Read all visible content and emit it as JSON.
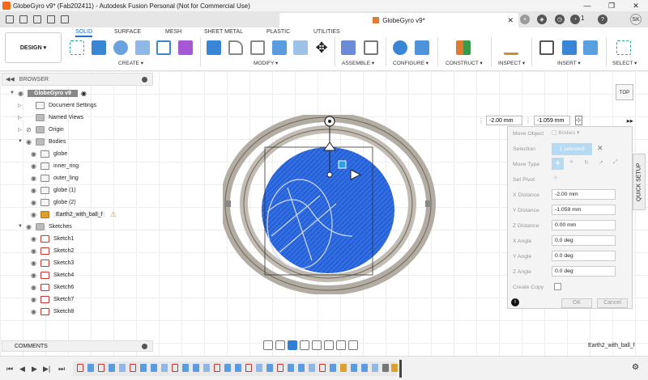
{
  "titlebar": {
    "title": "GlobeGyro v9* (Fab202411) - Autodesk Fusion Personal (Not for Commercial Use)"
  },
  "tabbar": {
    "doc_title": "GlobeGyro v9*",
    "notification_count": "1",
    "user_initials": "SK"
  },
  "ribbon": {
    "workspace": "DESIGN",
    "tabs": [
      "SOLID",
      "SURFACE",
      "MESH",
      "SHEET METAL",
      "PLASTIC",
      "UTILITIES"
    ],
    "groups": [
      "CREATE",
      "MODIFY",
      "ASSEMBLE",
      "CONFIGURE",
      "CONSTRUCT",
      "INSPECT",
      "INSERT",
      "SELECT"
    ]
  },
  "browser": {
    "header": "BROWSER",
    "root": "GlobeGyro v9",
    "items": [
      "Document Settings",
      "Named Views",
      "Origin",
      "Bodies",
      "globe",
      "inner_ring",
      "outer_ling",
      "globe (1)",
      "globe (2)",
      "Earth2_with_ball_f",
      "Sketches",
      "Sketch1",
      "Sketch2",
      "Sketch3",
      "Sketch4",
      "Sketch6",
      "Sketch7",
      "Sketch8"
    ]
  },
  "viewcube": {
    "label": "TOP"
  },
  "move_inputs": {
    "x": "-2.00 mm",
    "y": "-1.059 mm"
  },
  "move_dialog": {
    "move_object_label": "Move Object",
    "move_object_value": "Bodies",
    "selection_label": "Selection",
    "selection_value": "1 selected",
    "move_type_label": "Move Type",
    "set_pivot_label": "Set Pivot",
    "x_distance_label": "X Distance",
    "x_distance": "-2.00 mm",
    "y_distance_label": "Y Distance",
    "y_distance": "-1.059 mm",
    "z_distance_label": "Z Distance",
    "z_distance": "0.00 mm",
    "x_angle_label": "X Angle",
    "x_angle": "0.0 deg",
    "y_angle_label": "Y Angle",
    "y_angle": "0.0 deg",
    "z_angle_label": "Z Angle",
    "z_angle": "0.0 deg",
    "create_copy_label": "Create Copy",
    "ok": "OK",
    "cancel": "Cancel"
  },
  "quick_setup": "QUICK SETUP",
  "comments": "COMMENTS",
  "status": {
    "selected_name": "Earth2_with_ball_f"
  },
  "colors": {
    "accent": "#1b6ec2",
    "globe": "#2f6ee6",
    "ring": "#b3aca2"
  }
}
